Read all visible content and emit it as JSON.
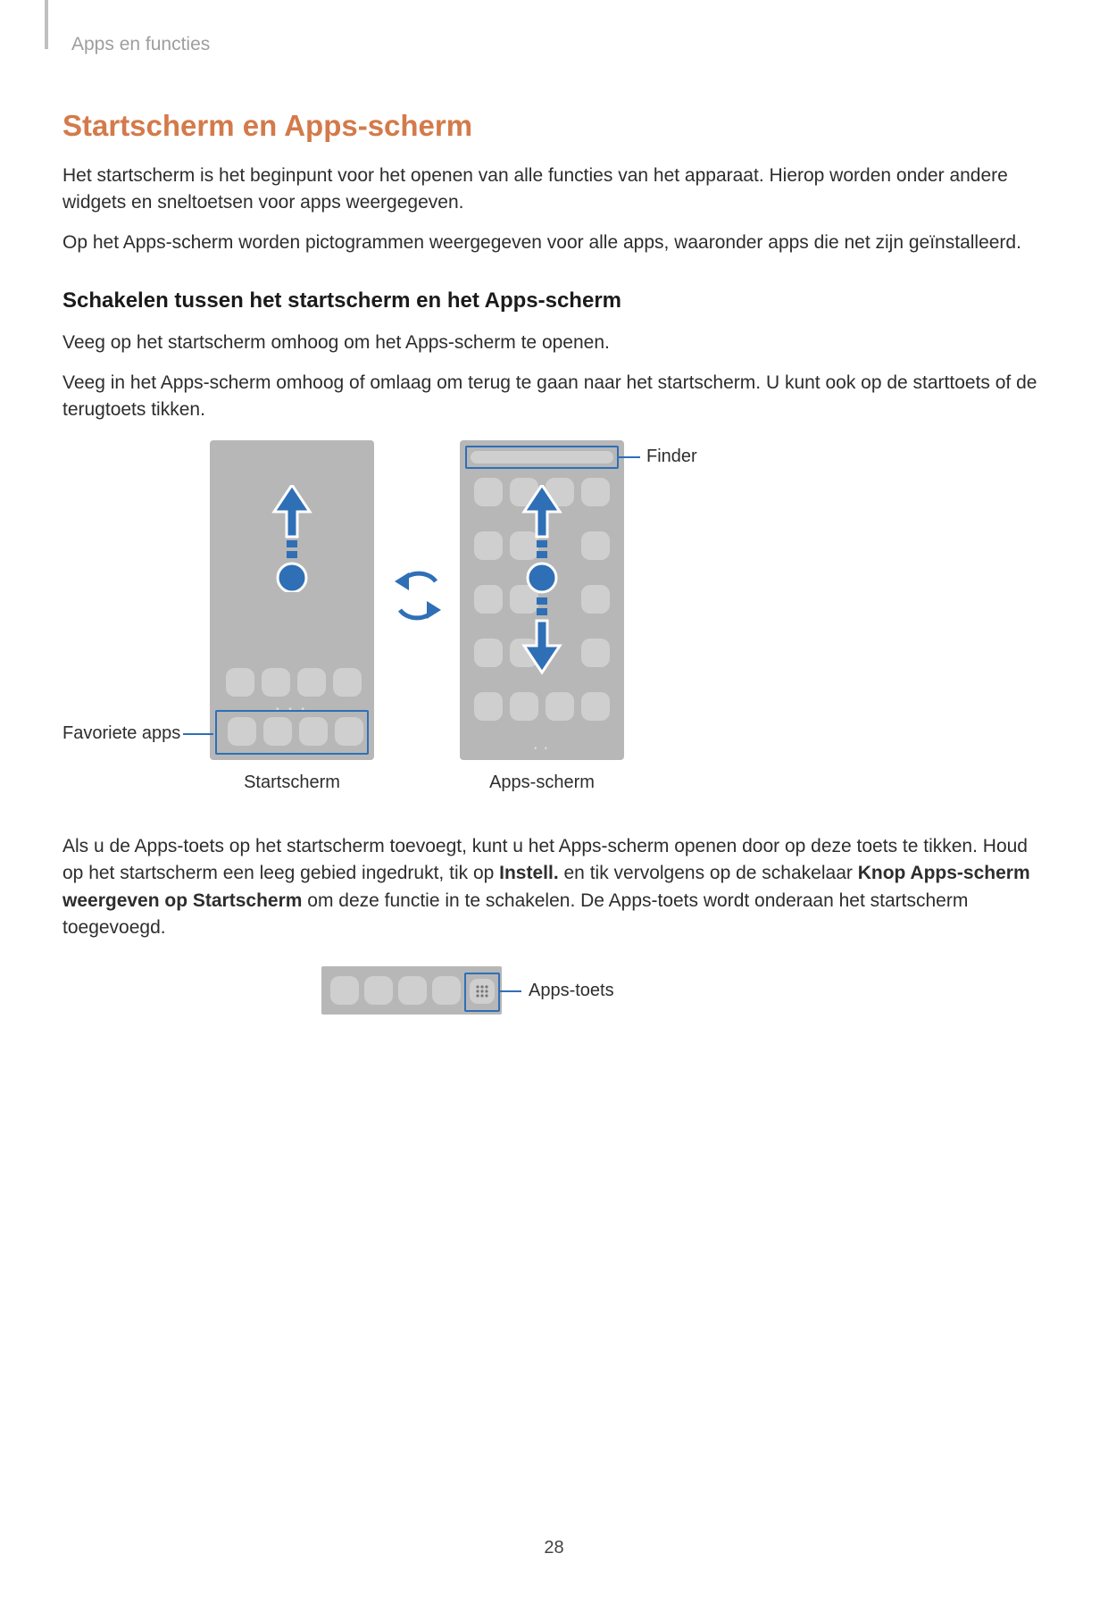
{
  "header": {
    "breadcrumb": "Apps en functies"
  },
  "title": "Startscherm en Apps-scherm",
  "para1": "Het startscherm is het beginpunt voor het openen van alle functies van het apparaat. Hierop worden onder andere widgets en sneltoetsen voor apps weergegeven.",
  "para2": "Op het Apps-scherm worden pictogrammen weergegeven voor alle apps, waaronder apps die net zijn geïnstalleerd.",
  "subheading": "Schakelen tussen het startscherm en het Apps-scherm",
  "para3": "Veeg op het startscherm omhoog om het Apps-scherm te openen.",
  "para4": "Veeg in het Apps-scherm omhoog of omlaag om terug te gaan naar het startscherm. U kunt ook op de starttoets of de terugtoets tikken.",
  "callouts": {
    "finder": "Finder",
    "fav": "Favoriete apps",
    "apps_toets": "Apps-toets"
  },
  "captions": {
    "left": "Startscherm",
    "right": "Apps-scherm"
  },
  "para5_a": "Als u de Apps-toets op het startscherm toevoegt, kunt u het Apps-scherm openen door op deze toets te tikken. Houd op het startscherm een leeg gebied ingedrukt, tik op ",
  "para5_b": "Instell.",
  "para5_c": " en tik vervolgens op de schakelaar ",
  "para5_d": "Knop Apps-scherm weergeven op Startscherm",
  "para5_e": " om deze functie in te schakelen. De Apps-toets wordt onderaan het startscherm toegevoegd.",
  "page_number": "28"
}
